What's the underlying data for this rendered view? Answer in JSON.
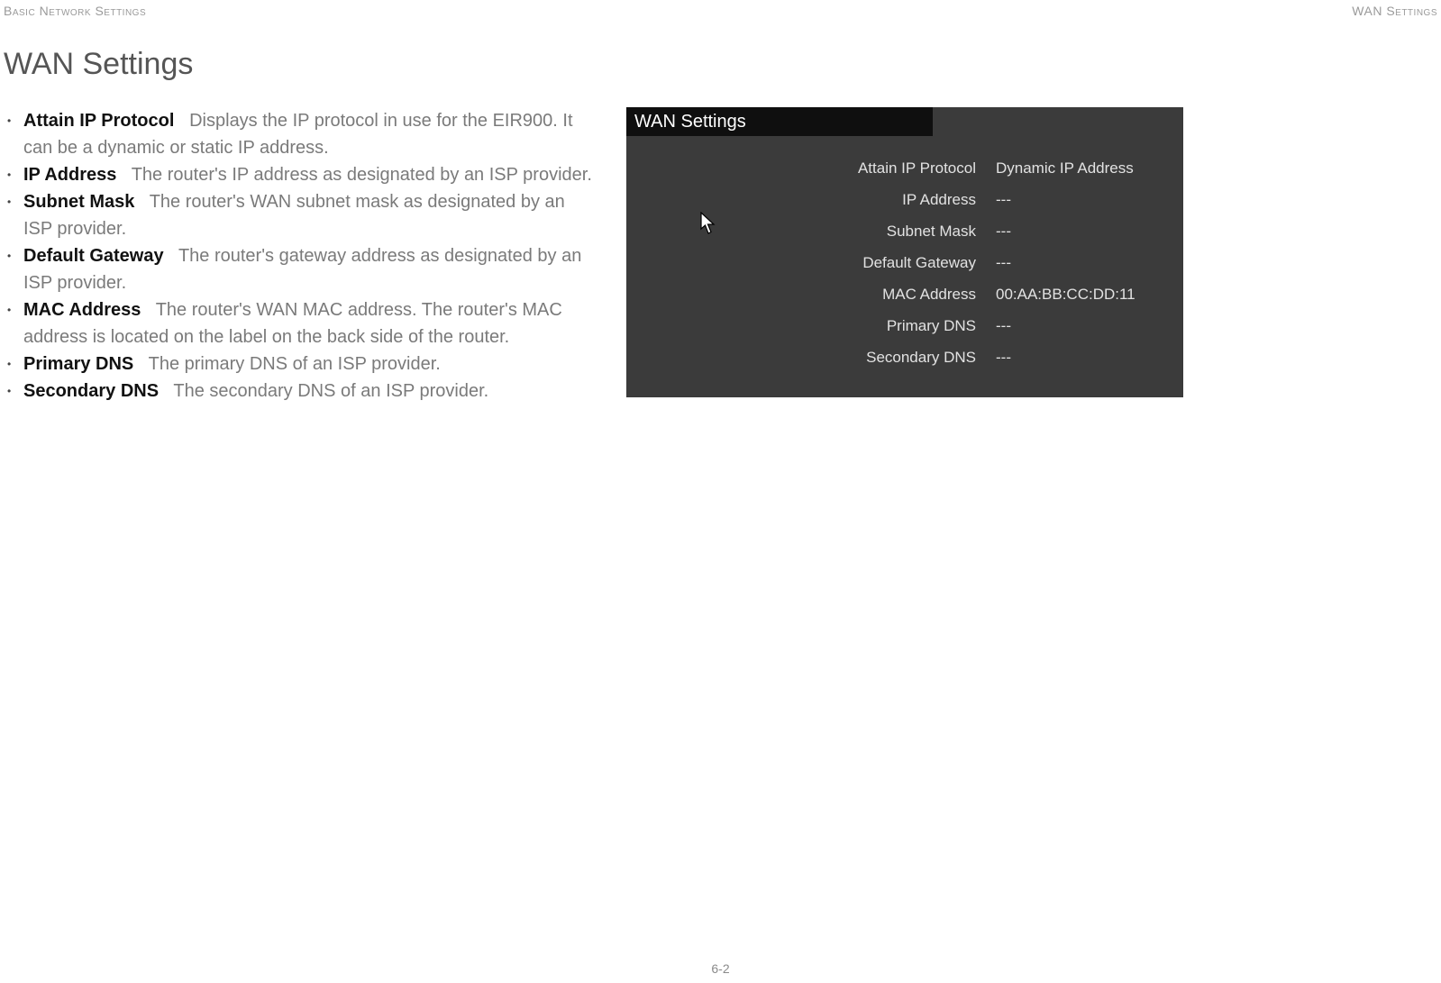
{
  "header": {
    "left": "Basic Network Settings",
    "right": "WAN Settings"
  },
  "heading": "WAN Settings",
  "bullets": [
    {
      "term": "Attain IP Protocol",
      "desc": "Displays the IP protocol in use for the EIR900. It can be a dynamic or static IP address."
    },
    {
      "term": "IP Address",
      "desc": "The router's IP address as designated by an ISP provider."
    },
    {
      "term": "Subnet Mask",
      "desc": "The router's WAN subnet mask as designated by an ISP provider."
    },
    {
      "term": "Default Gateway",
      "desc": "The router's gateway address as designated by an ISP provider."
    },
    {
      "term": "MAC Address",
      "desc": "The router's WAN MAC address. The router's MAC address is located on the label on the back side of the router."
    },
    {
      "term": "Primary DNS",
      "desc": "The primary DNS of an ISP provider."
    },
    {
      "term": "Secondary DNS",
      "desc": "The secondary DNS of an ISP provider."
    }
  ],
  "panel": {
    "title": "WAN Settings",
    "rows": [
      {
        "label": "Attain IP Protocol",
        "value": "Dynamic IP Address"
      },
      {
        "label": "IP Address",
        "value": "---"
      },
      {
        "label": "Subnet Mask",
        "value": "---"
      },
      {
        "label": "Default Gateway",
        "value": "---"
      },
      {
        "label": "MAC Address",
        "value": "00:AA:BB:CC:DD:11"
      },
      {
        "label": "Primary DNS",
        "value": "---"
      },
      {
        "label": "Secondary DNS",
        "value": "---"
      }
    ]
  },
  "page_number": "6-2"
}
